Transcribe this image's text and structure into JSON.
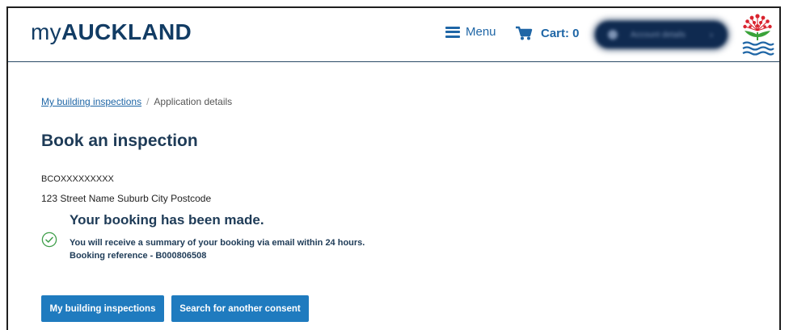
{
  "header": {
    "brand_prefix": "my",
    "brand_name": "AUCKLAND",
    "menu_label": "Menu",
    "cart_label": "Cart: 0",
    "account_label": "Account details",
    "colors": {
      "brand": "#123c64",
      "link": "#1f66a6",
      "button": "#1f7bbf"
    }
  },
  "breadcrumb": {
    "parent": "My building inspections",
    "separator": "/",
    "current": "Application details"
  },
  "page": {
    "title": "Book an inspection",
    "consent_number": "BCOXXXXXXXXX",
    "address": "123 Street Name Suburb City Postcode"
  },
  "confirmation": {
    "heading": "Your booking has been made.",
    "message": "You will receive a summary of your booking via email within 24 hours.",
    "reference": "Booking reference - B000806508",
    "icon": "check-circle-icon"
  },
  "actions": {
    "primary": "My building inspections",
    "secondary": "Search for another consent"
  }
}
